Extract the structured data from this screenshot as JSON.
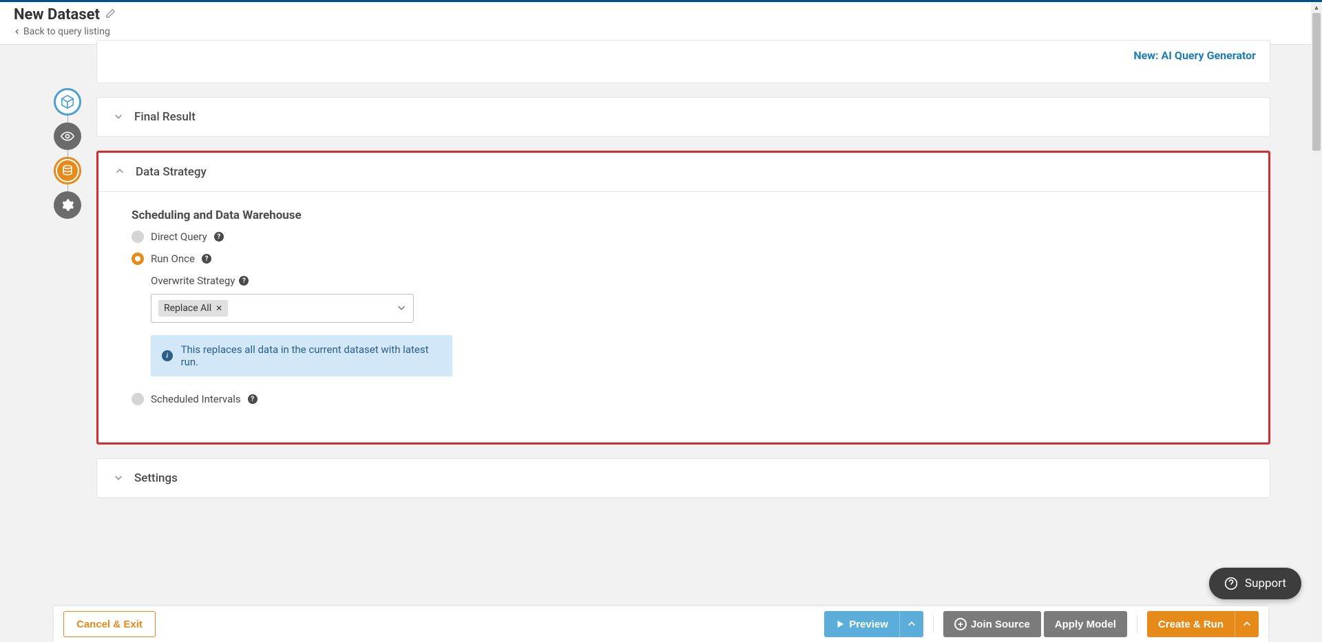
{
  "header": {
    "title": "New Dataset",
    "back_label": "Back to query listing"
  },
  "top_card": {
    "new_link": "New: AI Query Generator"
  },
  "sections": {
    "final_result": {
      "title": "Final Result"
    },
    "data_strategy": {
      "title": "Data Strategy",
      "sub_title": "Scheduling and Data Warehouse",
      "option_direct": "Direct Query",
      "option_run_once": "Run Once",
      "option_scheduled": "Scheduled Intervals",
      "overwrite_label": "Overwrite Strategy",
      "overwrite_value": "Replace All",
      "info_text": "This replaces all data in the current dataset with latest run."
    },
    "settings": {
      "title": "Settings"
    }
  },
  "support": {
    "label": "Support"
  },
  "footer": {
    "cancel": "Cancel & Exit",
    "preview": "Preview",
    "join_source": "Join Source",
    "apply_model": "Apply Model",
    "create_run": "Create & Run"
  }
}
